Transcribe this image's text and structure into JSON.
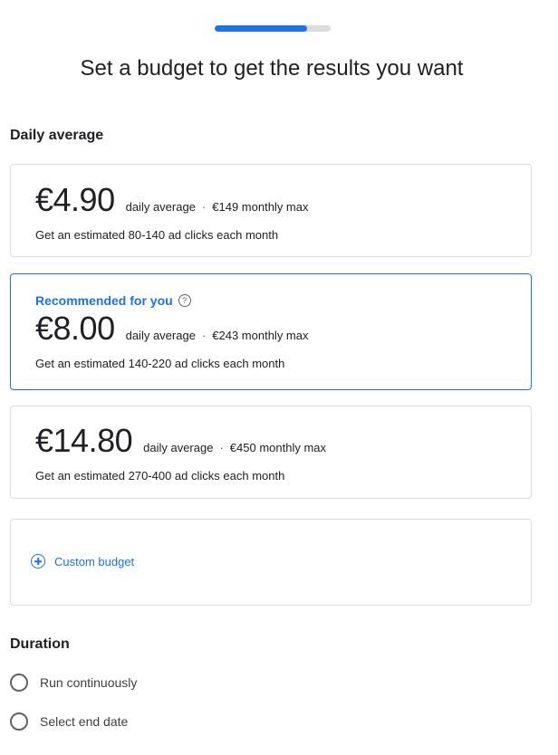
{
  "progress": {
    "fraction": 0.8
  },
  "header": {
    "title": "Set a budget to get the results you want"
  },
  "daily_average": {
    "section_title": "Daily average",
    "options": [
      {
        "price": "€4.90",
        "daily_label": "daily average",
        "separator": "·",
        "monthly": "€149 monthly max",
        "estimate": "Get an estimated 80-140 ad clicks each month",
        "selected": false
      },
      {
        "recommended_label": "Recommended for you",
        "help_icon": "help-circle-icon",
        "price": "€8.00",
        "daily_label": "daily average",
        "separator": "·",
        "monthly": "€243 monthly max",
        "estimate": "Get an estimated 140-220 ad clicks each month",
        "selected": true
      },
      {
        "price": "€14.80",
        "daily_label": "daily average",
        "separator": "·",
        "monthly": "€450 monthly max",
        "estimate": "Get an estimated 270-400 ad clicks each month",
        "selected": false
      }
    ],
    "custom": {
      "icon": "plus-circle-icon",
      "label": "Custom budget"
    }
  },
  "duration": {
    "section_title": "Duration",
    "options": [
      {
        "label": "Run continuously",
        "selected": false
      },
      {
        "label": "Select end date",
        "selected": false
      }
    ]
  },
  "colors": {
    "accent": "#1a73e8",
    "border": "#dadce0",
    "text": "#202124"
  }
}
